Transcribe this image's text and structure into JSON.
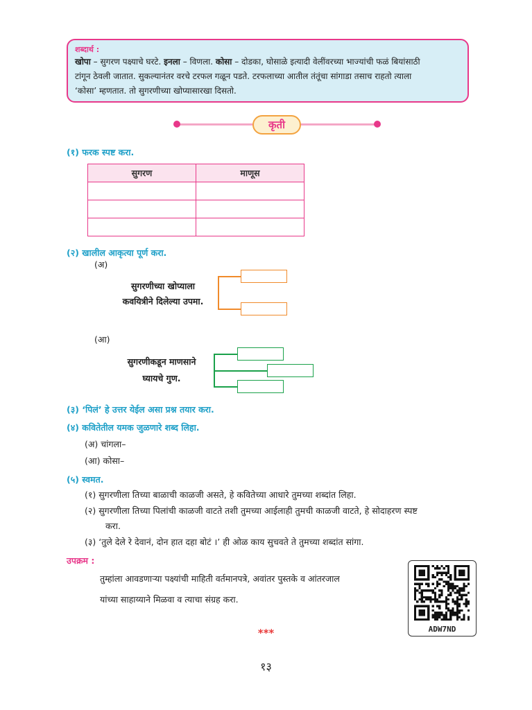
{
  "glossary": {
    "title": "शब्दार्थ :",
    "t1": "खोपा",
    "d1": " – सुगरण पक्ष्याचे घरटे. ",
    "t2": "इनला",
    "d2": " – विणला.  ",
    "t3": "कोसा",
    "d3": " – दोडका, घोसाळे इत्यादी वेलींवरच्या भाज्यांची फळं बियांसाठी",
    "line2": "टांगून ठेवली जातात. सुकल्यानंतर वरचे टरफल गळून पडते. टरफलाच्या आतील तंतूंचा सांगाडा तसाच राहतो त्याला",
    "line3": "‘कोसा’ म्हणतात. तो सुगरणीच्या खोप्यासारखा दिसतो."
  },
  "kruti": "कृती",
  "q1": {
    "heading": "(१)  फरक स्पष्ट करा.",
    "columns": [
      "सुगरण",
      "माणूस"
    ],
    "blank_rows": 3
  },
  "q2": {
    "heading": "(२)  खालील आकृत्या पूर्ण करा.",
    "a_label": "(अ)",
    "a_text1": "सुगरणीच्या खोप्याला",
    "a_text2": "कवयित्रीने दिलेल्या उपमा.",
    "aa_label": "(आ)",
    "aa_text1": "सुगरणीकडून माणसाने",
    "aa_text2": "घ्यायचे गुण."
  },
  "q3": {
    "heading": "(३)  ‘पिलं’ हे उत्तर येईल असा प्रश्न तयार करा."
  },
  "q4": {
    "heading": "(४)  कवितेतील यमक जुळणारे शब्द लिहा.",
    "items": [
      "(अ)   चांगला–",
      "(आ)  कोसा–"
    ]
  },
  "q5": {
    "heading": "(५)  स्वमत.",
    "items": [
      "(१)  सुगरणीला तिच्या बाळाची काळजी असते, हे कवितेच्या आधारे तुमच्या शब्दांत लिहा.",
      "(२)  सुगरणीला तिच्या पिलांची काळजी वाटते तशी तुमच्या आईलाही तुमची काळजी वाटते, हे सोदाहरण स्पष्ट",
      "करा.",
      "(३)  ‘तुले देले रे देवानं, दोन हात दहा बोटं ।’ ही ओळ काय सुचवते ते तुमच्या शब्दांत सांगा."
    ]
  },
  "upakram": {
    "heading": "उपक्रम :",
    "line1": "तुम्हांला आवडणाऱ्या पक्ष्यांची माहिती वर्तमानपत्रे, अवांतर पुस्तके व आंतरजाल",
    "line2": "यांच्या साहाय्याने मिळवा व त्याचा संग्रह करा."
  },
  "qr_caption": "ADW7ND",
  "stars": "***",
  "page_number": "१३",
  "colors": {
    "accent_pink": "#e8388a",
    "heading_blue": "#1fa0c8",
    "orange": "#f08a2a",
    "green": "#1aa14a"
  }
}
